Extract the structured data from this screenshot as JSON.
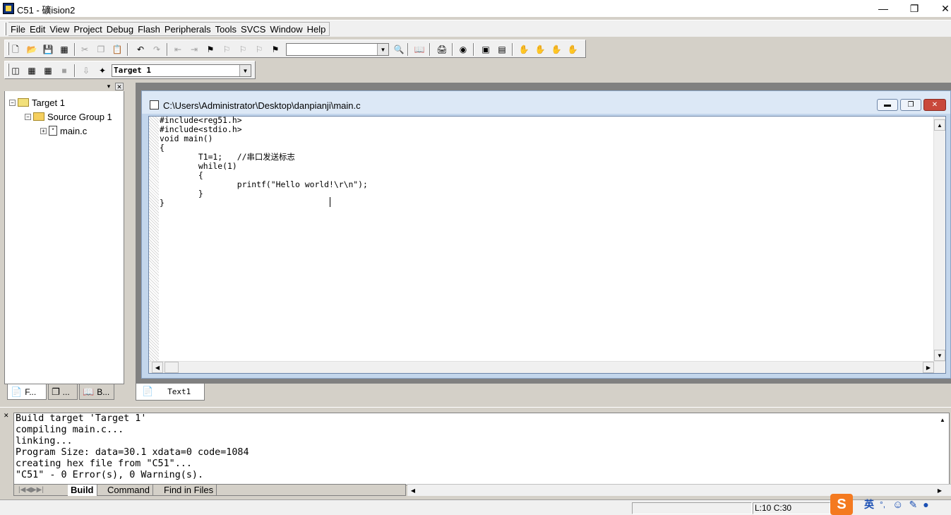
{
  "window": {
    "title": "C51  - 礦ision2"
  },
  "menubar": {
    "items": [
      "File",
      "Edit",
      "View",
      "Project",
      "Debug",
      "Flash",
      "Peripherals",
      "Tools",
      "SVCS",
      "Window",
      "Help"
    ]
  },
  "toolbar": {
    "find_combo_value": "",
    "target_combo_value": "Target 1"
  },
  "project": {
    "tree": [
      {
        "label": "Target 1"
      },
      {
        "label": "Source Group 1"
      },
      {
        "label": "main.c"
      }
    ],
    "tabs": [
      "F...",
      "...",
      "B..."
    ]
  },
  "editor": {
    "title": "C:\\Users\\Administrator\\Desktop\\danpianji\\main.c",
    "code": "#include<reg51.h>\n#include<stdio.h>\nvoid main()\n{\n        T1=1;   //串口发送标志\n        while(1)\n        {\n                printf(\"Hello world!\\r\\n\");\n        }\n}",
    "tab": "Text1"
  },
  "output": {
    "lines": [
      "Build target 'Target 1'",
      "compiling main.c...",
      "linking...",
      "Program Size: data=30.1 xdata=0 code=1084",
      "creating hex file from \"C51\"...",
      "\"C51\" - 0 Error(s), 0 Warning(s)."
    ],
    "tabs": {
      "build": "Build",
      "command": "Command",
      "find": "Find in Files"
    }
  },
  "status": {
    "position": "L:10 C:30"
  },
  "ime": {
    "lang": "英",
    "punct": "°,"
  }
}
